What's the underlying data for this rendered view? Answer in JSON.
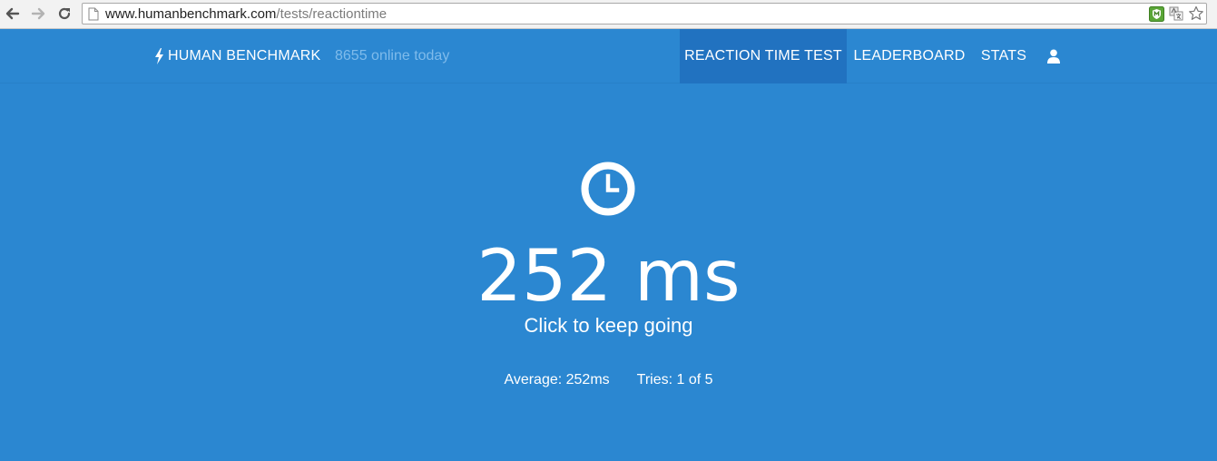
{
  "browser": {
    "url_host": "www.humanbenchmark.com",
    "url_path": "/tests/reactiontime",
    "icons": [
      "back-arrow-icon",
      "forward-arrow-icon",
      "reload-icon",
      "page-icon",
      "extension-shield-icon",
      "translate-icon",
      "bookmark-star-icon"
    ]
  },
  "header": {
    "brand": "HUMAN BENCHMARK",
    "online": "8655 online today",
    "nav": {
      "reaction": "REACTION TIME TEST",
      "leaderboard": "LEADERBOARD",
      "stats": "STATS"
    },
    "icons": [
      "lightning-bolt-icon",
      "user-icon"
    ]
  },
  "test": {
    "icon": "clock-icon",
    "result": "252 ms",
    "prompt": "Click to keep going",
    "average": "Average: 252ms",
    "tries": "Tries: 1 of 5"
  },
  "colors": {
    "background": "#2b87d1",
    "active_nav": "#2172c0",
    "muted_text": "#7fbbeb",
    "text": "#ffffff"
  }
}
